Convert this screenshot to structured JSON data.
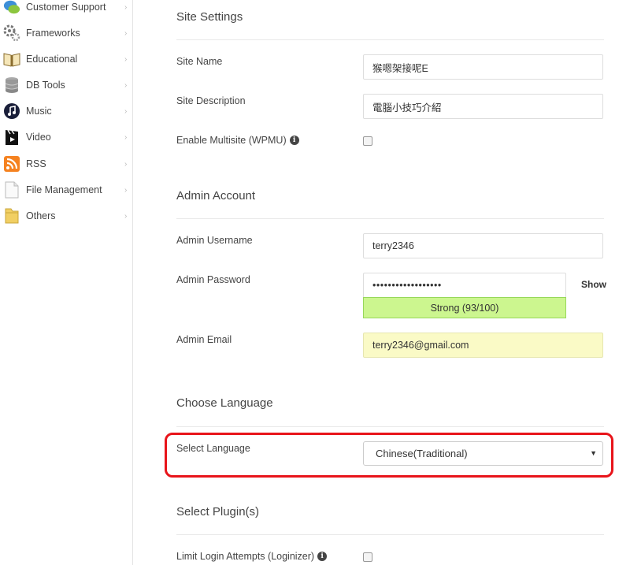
{
  "sidebar": {
    "items": [
      {
        "label": "Customer Support",
        "icon": "chat-bubbles-icon"
      },
      {
        "label": "Frameworks",
        "icon": "gears-icon"
      },
      {
        "label": "Educational",
        "icon": "open-book-icon"
      },
      {
        "label": "DB Tools",
        "icon": "database-icon"
      },
      {
        "label": "Music",
        "icon": "music-note-icon"
      },
      {
        "label": "Video",
        "icon": "clapperboard-icon"
      },
      {
        "label": "RSS",
        "icon": "rss-icon"
      },
      {
        "label": "File Management",
        "icon": "document-icon"
      },
      {
        "label": "Others",
        "icon": "folder-icon"
      }
    ]
  },
  "site_settings": {
    "title": "Site Settings",
    "site_name_label": "Site Name",
    "site_name_value": "猴嗯架接呢E",
    "site_description_label": "Site Description",
    "site_description_value": "電腦小技巧介紹",
    "multisite_label": "Enable Multisite (WPMU)"
  },
  "admin_account": {
    "title": "Admin Account",
    "username_label": "Admin Username",
    "username_value": "terry2346",
    "password_label": "Admin Password",
    "password_value": "••••••••••••••••••",
    "show_label": "Show",
    "strength_label": "Strong (93/100)",
    "email_label": "Admin Email",
    "email_value": "terry2346@gmail.com"
  },
  "language": {
    "title": "Choose Language",
    "select_label": "Select Language",
    "selected": "Chinese(Traditional)"
  },
  "plugins": {
    "title": "Select Plugin(s)",
    "limit_login_label": "Limit Login Attempts (Loginizer)"
  },
  "colors": {
    "highlight": "#e8141a",
    "strength_fill": "#ccf68f",
    "email_fill": "#fafac6"
  }
}
